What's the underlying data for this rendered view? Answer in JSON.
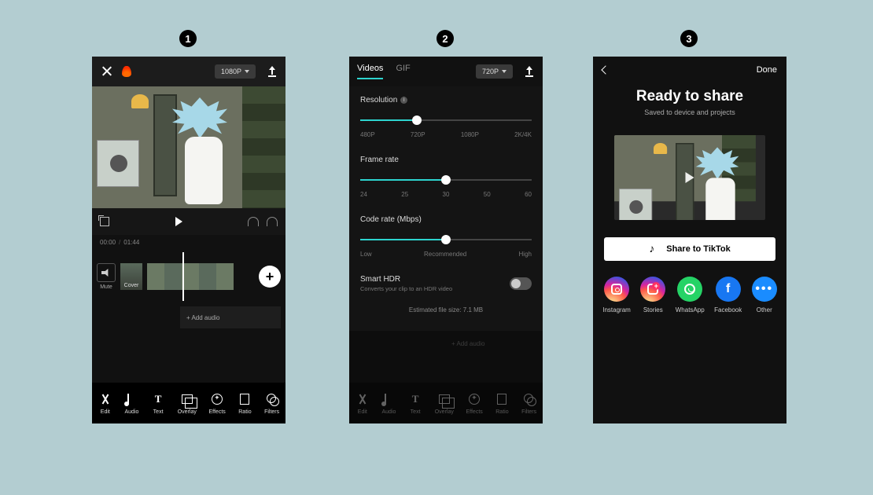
{
  "steps": [
    "1",
    "2",
    "3"
  ],
  "p1": {
    "resolution_label": "1080P",
    "time_current": "00:00",
    "time_total": "01:44",
    "mute_label": "Mute",
    "cover_label": "Cover",
    "add_audio": "+ Add audio",
    "tools": {
      "edit": "Edit",
      "audio": "Audio",
      "text": "Text",
      "overlay": "Overlay",
      "effects": "Effects",
      "ratio": "Ratio",
      "filters": "Filters"
    }
  },
  "p2": {
    "tab_videos": "Videos",
    "tab_gif": "GIF",
    "resolution_label": "720P",
    "sliders": {
      "resolution": {
        "label": "Resolution",
        "ticks": [
          "480P",
          "720P",
          "1080P",
          "2K/4K"
        ],
        "fill_pct": 33
      },
      "frame_rate": {
        "label": "Frame rate",
        "ticks": [
          "24",
          "25",
          "30",
          "50",
          "60"
        ],
        "fill_pct": 50
      },
      "code_rate": {
        "label": "Code rate (Mbps)",
        "ticks": [
          "Low",
          "Recommended",
          "High"
        ],
        "fill_pct": 50
      }
    },
    "hdr_label": "Smart HDR",
    "hdr_sub": "Converts your clip to an HDR video",
    "est": "Estimated file size: 7.1 MB",
    "add_audio": "+ Add audio",
    "tools": {
      "edit": "Edit",
      "audio": "Audio",
      "text": "Text",
      "overlay": "Overlay",
      "effects": "Effects",
      "ratio": "Ratio",
      "filters": "Filters"
    }
  },
  "p3": {
    "done": "Done",
    "title": "Ready to share",
    "sub": "Saved to device and projects",
    "share_btn": "Share to TikTok",
    "targets": {
      "instagram": "Instagram",
      "stories": "Stories",
      "whatsapp": "WhatsApp",
      "facebook": "Facebook",
      "other": "Other"
    }
  }
}
